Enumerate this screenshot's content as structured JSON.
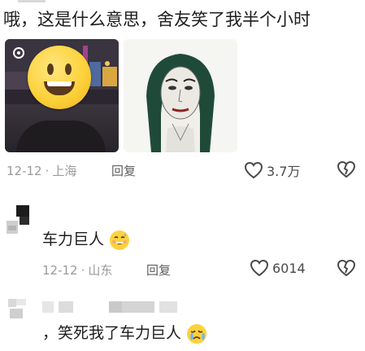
{
  "comment_1": {
    "text": "哦，这是什么意思，舍友笑了我半个小时",
    "date": "12-12",
    "location": "上海",
    "reply_label": "回复",
    "like_count": "3.7万"
  },
  "comment_2": {
    "text": "车力巨人",
    "date": "12-12",
    "location": "山东",
    "reply_label": "回复",
    "like_count": "6014"
  },
  "comment_3": {
    "text": "，笑死我了车力巨人"
  },
  "colors": {
    "accent_meta": "#9a9a9a",
    "icon_stroke": "#4a4a4a"
  }
}
